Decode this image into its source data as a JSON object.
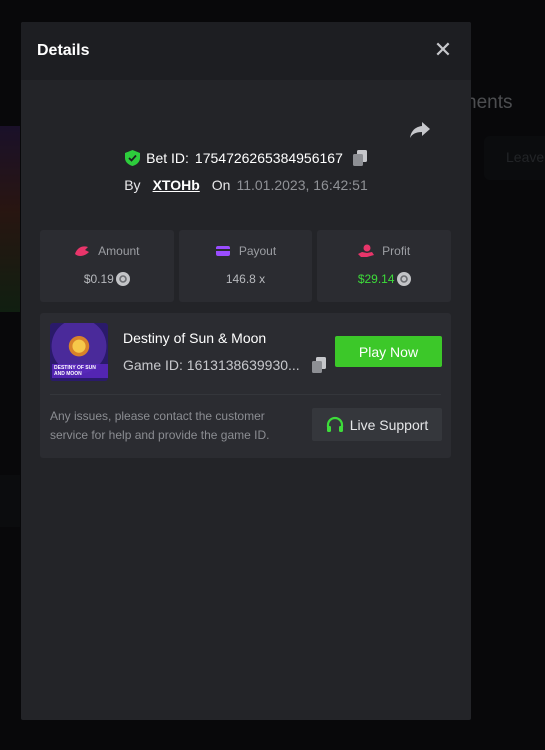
{
  "background": {
    "heading": "nents",
    "button_label": "Leave"
  },
  "modal": {
    "title": "Details",
    "close_glyph": "✕",
    "bet": {
      "label": "Bet ID:",
      "id": "1754726265384956167",
      "by_label": "By",
      "user": "XTOHb",
      "on_label": "On",
      "date": "11.01.2023, 16:42:51"
    },
    "stats": {
      "amount": {
        "label": "Amount",
        "value": "$0.19",
        "icon": "amount-icon",
        "color": "#e8356a"
      },
      "payout": {
        "label": "Payout",
        "value": "146.8 x",
        "icon": "payout-icon",
        "color": "#9a4dff"
      },
      "profit": {
        "label": "Profit",
        "value": "$29.14",
        "icon": "profit-icon",
        "color": "#e8356a",
        "value_color": "#3ddc3a"
      }
    },
    "game": {
      "name": "Destiny of Sun & Moon",
      "id_label": "Game ID:",
      "id": "1613138639930...",
      "thumb_text": "Destiny of Sun and Moon",
      "play_label": "Play Now"
    },
    "support": {
      "message": "Any issues, please contact the customer service for help and provide the game ID.",
      "button_label": "Live Support",
      "icon": "headset-icon"
    }
  },
  "colors": {
    "accent_green": "#3cc829",
    "shield_green": "#2dcc3c",
    "modal_bg": "#232428"
  }
}
